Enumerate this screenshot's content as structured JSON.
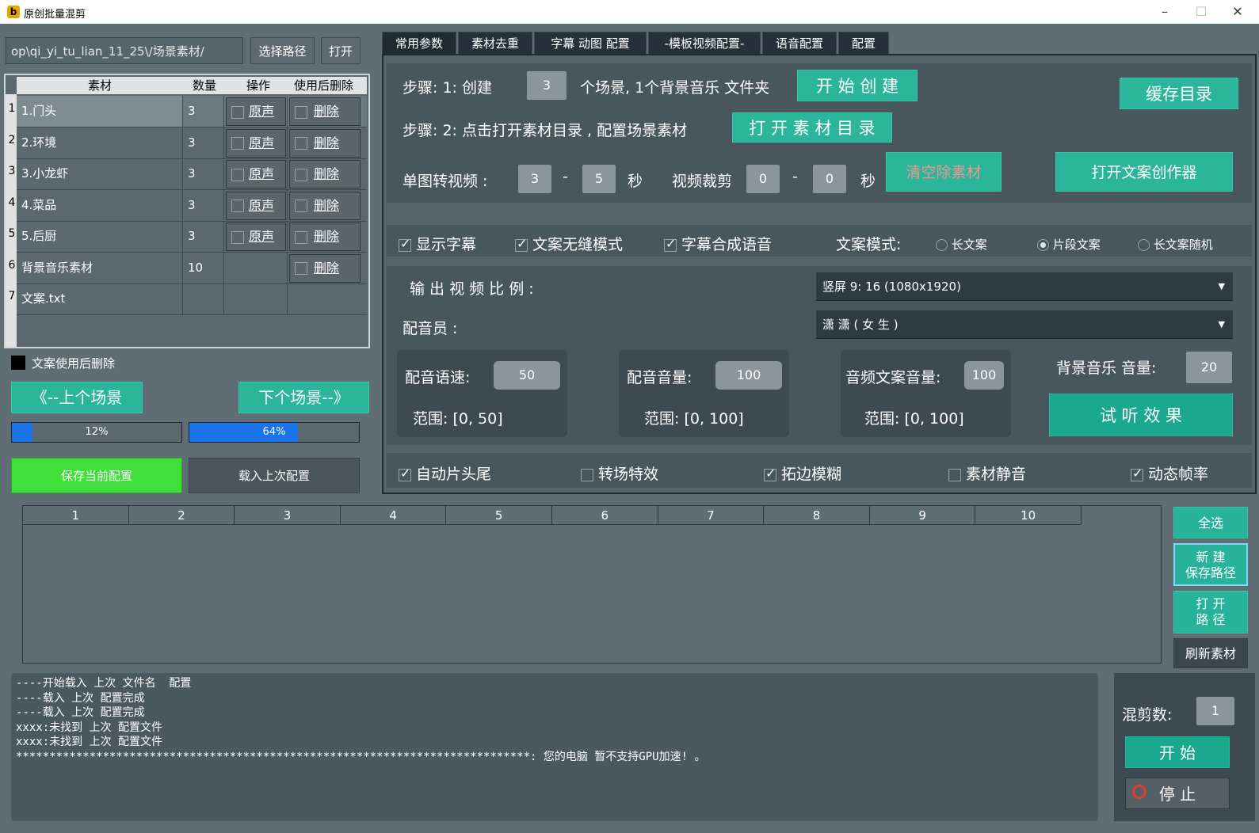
{
  "window": {
    "title": "原创批量混剪"
  },
  "path": {
    "value": "op\\qi_yi_tu_lian_11_25\\/场景素材/",
    "select_label": "选择路径",
    "open_label": "打开"
  },
  "table": {
    "headers": [
      "素材",
      "数量",
      "操作",
      "使用后删除"
    ],
    "rows": [
      {
        "index": "1",
        "name": "1.门头",
        "count": "3",
        "op": "原声",
        "del": "删除"
      },
      {
        "index": "2",
        "name": "2.环境",
        "count": "3",
        "op": "原声",
        "del": "删除"
      },
      {
        "index": "3",
        "name": "3.小龙虾",
        "count": "3",
        "op": "原声",
        "del": "删除"
      },
      {
        "index": "4",
        "name": "4.菜品",
        "count": "3",
        "op": "原声",
        "del": "删除"
      },
      {
        "index": "5",
        "name": "5.后厨",
        "count": "3",
        "op": "原声",
        "del": "删除"
      },
      {
        "index": "6",
        "name": "背景音乐素材",
        "count": "10",
        "op": "",
        "del": "删除"
      },
      {
        "index": "7",
        "name": "文案.txt",
        "count": "",
        "op": "",
        "del": ""
      }
    ]
  },
  "left": {
    "delete_after_use": "文案使用后删除",
    "prev_scene": "《--上个场景",
    "next_scene": "下个场景--》",
    "progress1": {
      "label": "12%",
      "value": 0.12
    },
    "progress2": {
      "label": "64%",
      "value": 0.64
    },
    "save_config": "保存当前配置",
    "load_config": "载入上次配置"
  },
  "tabs": [
    "常用参数",
    "素材去重",
    "字幕 动图 配置",
    "-模板视频配置-",
    "语音配置",
    "配置"
  ],
  "step1": {
    "prefix": "步骤: 1: 创建",
    "count": "3",
    "suffix": "个场景, 1个背景音乐 文件夹",
    "button": "开 始 创 建"
  },
  "cache_button": "缓存目录",
  "step2": {
    "label": "步骤: 2: 点击打开素材目录 , 配置场景素材",
    "button": "打 开 素 材 目 录"
  },
  "transition": {
    "label": "单图转视频 :",
    "min": "3",
    "dash": "-",
    "max": "5",
    "unit": "秒"
  },
  "crop": {
    "label": "视频裁剪",
    "min": "0",
    "dash": "-",
    "max": "0",
    "unit": "秒"
  },
  "clear_button": "清空除素材",
  "copywriter_button": "打开文案创作器",
  "options1": {
    "show_subtitle": "显示字幕",
    "seamless": "文案无缝模式",
    "subtitle_voice": "字幕合成语音",
    "mode_label": "文案模式:",
    "mode_long": "长文案",
    "mode_segment": "片段文案",
    "mode_long_random": "长文案随机"
  },
  "ratio": {
    "label": "输 出 视 频 比 例 :",
    "value": "竖屏  9: 16 (1080x1920)"
  },
  "voice": {
    "label": "配音员 :",
    "value": "潇 潇 ( 女 生 )"
  },
  "speed": {
    "label": "配音语速:",
    "value": "50",
    "range": "范围: [0, 50]"
  },
  "volume": {
    "label": "配音音量:",
    "value": "100",
    "range": "范围: [0, 100]"
  },
  "audio_volume": {
    "label": "音频文案音量:",
    "value": "100",
    "range": "范围: [0, 100]"
  },
  "bgm": {
    "label": "背景音乐 音量:",
    "value": "20"
  },
  "preview_button": "试 听 效 果",
  "options2": {
    "auto_head_tail": "自动片头尾",
    "transition_fx": "转场特效",
    "edge_blur": "拓边模糊",
    "mute_material": "素材静音",
    "dynamic_fps": "动态帧率"
  },
  "grid": {
    "columns": [
      "1",
      "2",
      "3",
      "4",
      "5",
      "6",
      "7",
      "8",
      "9",
      "10"
    ]
  },
  "right_buttons": {
    "select_all": "全选",
    "new_save_path": "新 建\n保存路径",
    "open_path": "打 开\n路 径",
    "refresh": "刷新素材"
  },
  "log": "----开始载入 上次 文件名  配置\n----载入 上次 配置完成\n----载入 上次 配置完成\nxxxx:未找到 上次 配置文件\nxxxx:未找到 上次 配置文件\n*****************************************************************************: 您的电脑 暂不支持GPU加速! 。",
  "mix": {
    "label": "混剪数:",
    "value": "1",
    "start": "开 始",
    "stop": "停 止"
  },
  "colors": {
    "teal": "#2bb59a",
    "green": "#3fe03a",
    "progress_blue": "#1a73e8",
    "panel": "#4a5860"
  }
}
